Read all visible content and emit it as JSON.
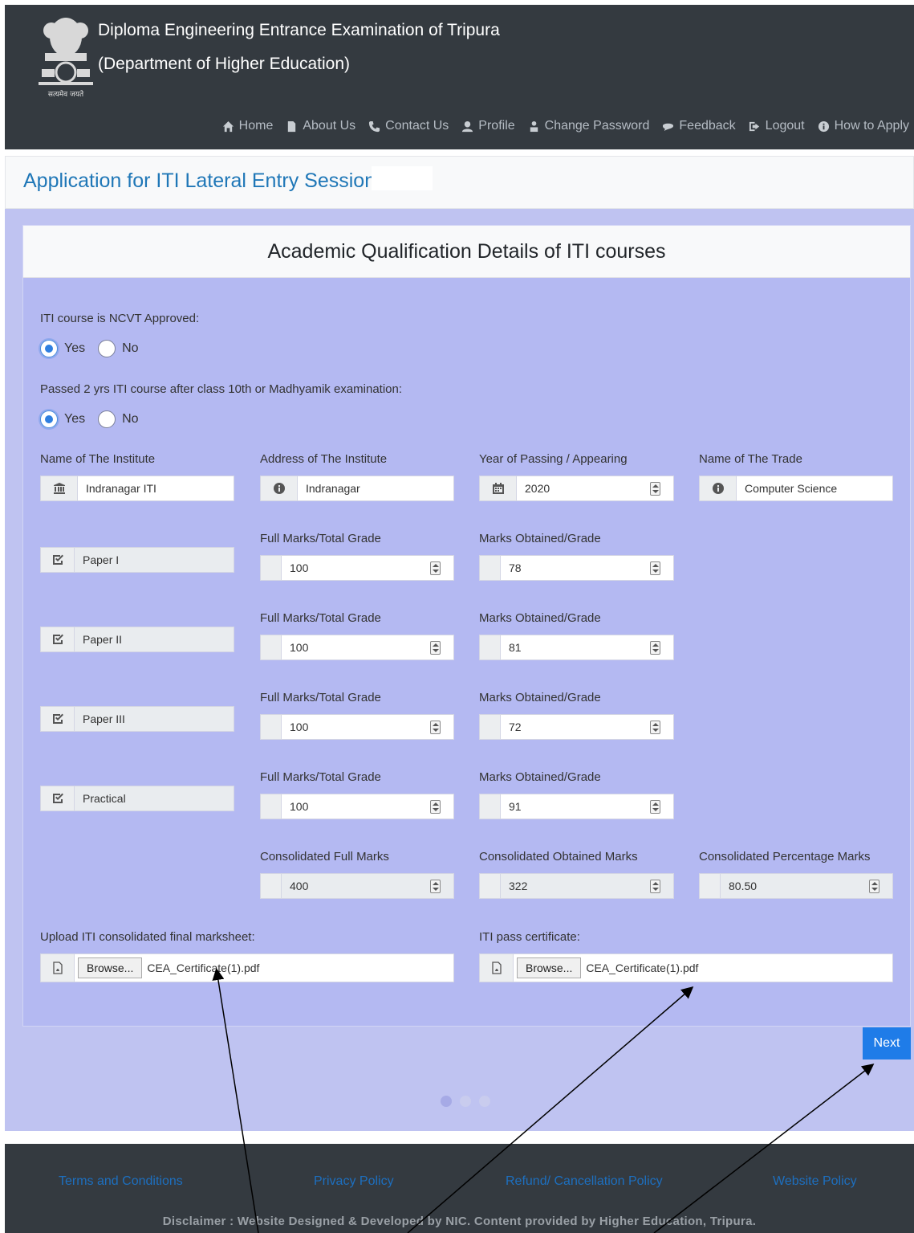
{
  "header": {
    "title_line1": "Diploma Engineering Entrance Examination of Tripura",
    "title_line2": "(Department of Higher Education)",
    "emblem_motto": "सत्यमेव जयते",
    "nav": [
      {
        "label": "Home",
        "icon": "home-icon"
      },
      {
        "label": "About Us",
        "icon": "document-icon"
      },
      {
        "label": "Contact Us",
        "icon": "phone-icon"
      },
      {
        "label": "Profile",
        "icon": "user-icon"
      },
      {
        "label": "Change Password",
        "icon": "user-lock-icon"
      },
      {
        "label": "Feedback",
        "icon": "comment-icon"
      },
      {
        "label": "Logout",
        "icon": "logout-icon"
      },
      {
        "label": "How to Apply",
        "icon": "info-icon"
      }
    ]
  },
  "page_title": "Application for ITI Lateral Entry Session",
  "card_title": "Academic Qualification Details of ITI courses",
  "q1": {
    "label": "ITI course is NCVT Approved:",
    "yes": "Yes",
    "no": "No",
    "selected": "Yes"
  },
  "q2": {
    "label": "Passed 2 yrs ITI course after class 10th or Madhyamik examination:",
    "yes": "Yes",
    "no": "No",
    "selected": "Yes"
  },
  "institute": {
    "name_label": "Name of The Institute",
    "name_value": "Indranagar ITI",
    "address_label": "Address of The Institute",
    "address_value": "Indranagar",
    "year_label": "Year of Passing / Appearing",
    "year_value": "2020",
    "trade_label": "Name of The Trade",
    "trade_value": "Computer Science"
  },
  "full_marks_label": "Full Marks/Total Grade",
  "obtained_label": "Marks Obtained/Grade",
  "papers": [
    {
      "name": "Paper I",
      "full": "100",
      "obtained": "78"
    },
    {
      "name": "Paper II",
      "full": "100",
      "obtained": "81"
    },
    {
      "name": "Paper III",
      "full": "100",
      "obtained": "72"
    },
    {
      "name": "Practical",
      "full": "100",
      "obtained": "91"
    }
  ],
  "consolidated": {
    "full_label": "Consolidated Full Marks",
    "full_value": "400",
    "obtained_label": "Consolidated Obtained Marks",
    "obtained_value": "322",
    "percent_label": "Consolidated Percentage Marks",
    "percent_value": "80.50"
  },
  "uploads": {
    "marksheet_label": "Upload ITI consolidated final marksheet:",
    "certificate_label": "ITI pass certificate:",
    "browse_label": "Browse...",
    "marksheet_file": "CEA_Certificate(1).pdf",
    "certificate_file": "CEA_Certificate(1).pdf"
  },
  "next_label": "Next",
  "footer": {
    "links": [
      "Terms and Conditions",
      "Privacy Policy",
      "Refund/ Cancellation Policy",
      "Website Policy"
    ],
    "disclaimer": "Disclaimer : Website Designed & Developed by NIC. Content provided by Higher Education, Tripura."
  },
  "colors": {
    "header_bg": "#343a40",
    "main_bg": "#bfc3f1",
    "accent": "#1f7ce8",
    "title": "#1f77b7"
  }
}
